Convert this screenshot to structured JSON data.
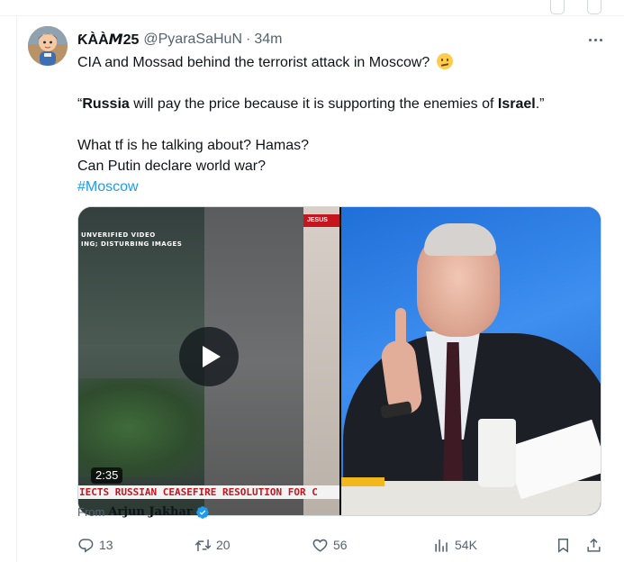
{
  "tweet": {
    "display_name": "ƘÀÀ𝙈25",
    "handle": "@PyaraSaHuN",
    "separator": "·",
    "time": "34m",
    "lines": {
      "line1": "CIA and Mossad behind the terrorist attack in Moscow?",
      "quote_open": "“",
      "quote_bold1": "Russia",
      "quote_mid": " will pay the price because it is supporting the enemies of ",
      "quote_bold2": "Israel",
      "quote_close": ".”",
      "line3": "What tf is he talking about? Hamas?",
      "line4": "Can Putin declare world war?",
      "hashtag": "#Moscow"
    },
    "emoji_icon": "thinking-face-emoji"
  },
  "media": {
    "video": {
      "overlay_text_1": "UNVERIFIED VIDEO",
      "overlay_text_2": "ING; DISTURBING IMAGES",
      "corner_tag": "JESUS",
      "chyron": "IECTS RUSSIAN CEASEFIRE RESOLUTION FOR C",
      "duration": "2:35"
    }
  },
  "attribution": {
    "prefix": "From",
    "name": "Arjun Jakhar"
  },
  "actions": {
    "replies": "13",
    "reposts": "20",
    "likes": "56",
    "views": "54K"
  },
  "colors": {
    "accent": "#1d9bf0",
    "text": "#0f1419",
    "muted": "#536471",
    "border": "#cfd9de"
  }
}
